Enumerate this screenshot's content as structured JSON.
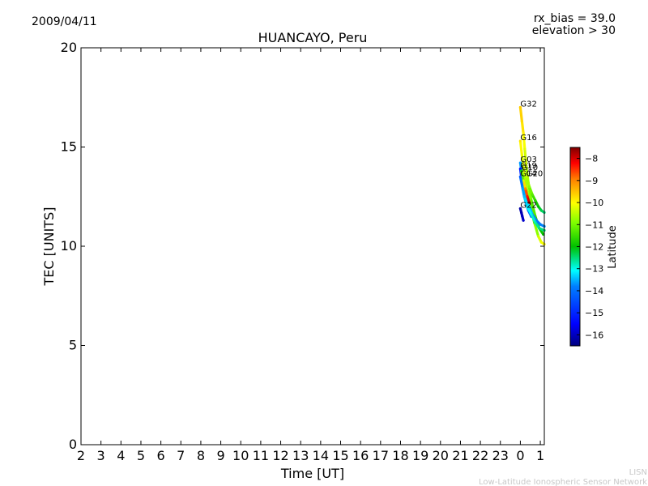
{
  "header": {
    "date": "2009/04/11",
    "rx_bias": "rx_bias = 39.0",
    "elevation": "elevation > 30"
  },
  "footer": {
    "line1": "LISN",
    "line2": "Low-Latitude Ionospheric Sensor Network"
  },
  "colors": {
    "frame": "#000000",
    "footer_text": "#c8c8c8",
    "colormap": [
      "#00007f",
      "#0000ff",
      "#007fff",
      "#00ffff",
      "#00c000",
      "#7fff00",
      "#ffff00",
      "#ff7f00",
      "#ff0000",
      "#7f0000"
    ]
  },
  "chart_data": {
    "type": "scatter",
    "title": "HUANCAYO, Peru",
    "xlabel": "Time [UT]",
    "ylabel": "TEC [UNITS]",
    "xlim": [
      2,
      25.2
    ],
    "ylim": [
      0,
      20
    ],
    "xticks": [
      2,
      3,
      4,
      5,
      6,
      7,
      8,
      9,
      10,
      11,
      12,
      13,
      14,
      15,
      16,
      17,
      18,
      19,
      20,
      21,
      22,
      23,
      24,
      25
    ],
    "xtick_labels": [
      "2",
      "3",
      "4",
      "5",
      "6",
      "7",
      "8",
      "9",
      "10",
      "11",
      "12",
      "13",
      "14",
      "15",
      "16",
      "17",
      "18",
      "19",
      "20",
      "21",
      "22",
      "23",
      "0",
      "1"
    ],
    "yticks": [
      0,
      5,
      10,
      15,
      20
    ],
    "grid": false,
    "colorbar": {
      "label": "Latitude",
      "range": [
        -16.5,
        -7.5
      ],
      "ticks": [
        -16,
        -15,
        -14,
        -13,
        -12,
        -11,
        -10,
        -9,
        -8
      ]
    },
    "series": [
      {
        "name": "G32",
        "points": [
          [
            24.0,
            17.0,
            -10.1
          ],
          [
            24.08,
            16.3,
            -10.2
          ],
          [
            24.15,
            15.7,
            -10.4
          ],
          [
            24.22,
            14.9,
            -10.7
          ],
          [
            24.3,
            14.0,
            -11.0
          ],
          [
            24.4,
            13.2,
            -11.3
          ],
          [
            24.55,
            12.3,
            -11.7
          ],
          [
            24.75,
            11.5,
            -12.0
          ],
          [
            24.95,
            10.9,
            -12.3
          ],
          [
            25.15,
            10.6,
            -12.5
          ]
        ]
      },
      {
        "name": "G16",
        "points": [
          [
            24.0,
            15.3,
            -10.3
          ],
          [
            24.08,
            14.6,
            -10.6
          ],
          [
            24.2,
            13.6,
            -11.0
          ],
          [
            24.35,
            12.7,
            -11.3
          ],
          [
            24.5,
            12.0,
            -11.6
          ],
          [
            24.7,
            11.2,
            -11.9
          ],
          [
            24.9,
            10.5,
            -10.9
          ],
          [
            25.05,
            10.2,
            -10.6
          ],
          [
            25.2,
            10.1,
            -10.5
          ]
        ]
      },
      {
        "name": "G03",
        "points": [
          [
            24.0,
            14.2,
            -14.3
          ],
          [
            24.08,
            13.6,
            -14.1
          ],
          [
            24.18,
            13.0,
            -13.8
          ],
          [
            24.3,
            12.4,
            -13.5
          ],
          [
            24.45,
            12.0,
            -13.9
          ],
          [
            24.6,
            11.6,
            -14.3
          ],
          [
            24.8,
            11.3,
            -14.6
          ],
          [
            25.0,
            11.1,
            -14.5
          ],
          [
            25.2,
            11.0,
            -14.4
          ]
        ]
      },
      {
        "name": "G19",
        "points": [
          [
            24.0,
            13.9,
            -15.4
          ],
          [
            24.06,
            13.4,
            -15.0
          ],
          [
            24.12,
            12.9,
            -14.6
          ],
          [
            24.2,
            12.5,
            -14.3
          ],
          [
            24.3,
            12.1,
            -14.0
          ],
          [
            24.4,
            11.8,
            -14.5
          ],
          [
            24.55,
            11.5,
            -14.8
          ]
        ]
      },
      {
        "name": "G10",
        "points": [
          [
            24.05,
            13.8,
            -12.6
          ],
          [
            24.15,
            13.3,
            -10.8
          ],
          [
            24.25,
            12.9,
            -9.6
          ],
          [
            24.35,
            12.5,
            -8.6
          ],
          [
            24.45,
            12.2,
            -7.9
          ]
        ]
      },
      {
        "name": "G14",
        "points": [
          [
            24.0,
            13.5,
            -14.8
          ],
          [
            24.1,
            13.0,
            -14.4
          ],
          [
            24.2,
            12.5,
            -14.0
          ],
          [
            24.35,
            12.0,
            -13.6
          ],
          [
            24.55,
            11.6,
            -13.4
          ],
          [
            24.75,
            11.2,
            -13.2
          ],
          [
            24.95,
            10.9,
            -13.0
          ],
          [
            25.2,
            10.8,
            -13.0
          ]
        ]
      },
      {
        "name": "G20",
        "points": [
          [
            24.3,
            13.5,
            -11.0
          ],
          [
            24.45,
            13.0,
            -11.4
          ],
          [
            24.6,
            12.6,
            -11.8
          ],
          [
            24.75,
            12.3,
            -12.2
          ],
          [
            24.9,
            12.0,
            -12.5
          ],
          [
            25.05,
            11.8,
            -12.8
          ],
          [
            25.2,
            11.7,
            -13.0
          ]
        ]
      },
      {
        "name": "G22",
        "points": [
          [
            24.0,
            11.9,
            -16.2
          ],
          [
            24.05,
            11.7,
            -16.1
          ],
          [
            24.1,
            11.5,
            -16.0
          ],
          [
            24.15,
            11.3,
            -15.9
          ]
        ]
      }
    ]
  }
}
